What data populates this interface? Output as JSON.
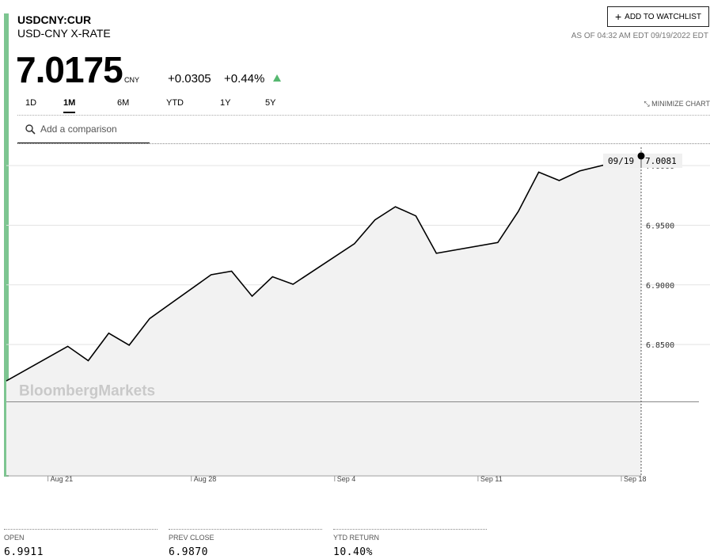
{
  "header": {
    "ticker": "USDCNY:CUR",
    "name": "USD-CNY X-RATE",
    "price": "7.0175",
    "currency": "CNY",
    "change": "+0.0305",
    "change_pct": "+0.44%",
    "change_direction": "up",
    "watchlist_label": "ADD TO WATCHLIST",
    "as_of": "AS OF 04:32 AM EDT 09/19/2022 EDT"
  },
  "tabs": [
    {
      "label": "1D",
      "active": false
    },
    {
      "label": "1M",
      "active": true
    },
    {
      "label": "6M",
      "active": false
    },
    {
      "label": "YTD",
      "active": false
    },
    {
      "label": "1Y",
      "active": false
    },
    {
      "label": "5Y",
      "active": false
    }
  ],
  "minimize_label": "MINIMIZE CHART",
  "comparison_placeholder": "Add a comparison",
  "watermark": "BloombergMarkets",
  "tooltip": {
    "date": "09/19",
    "value": "7.0081"
  },
  "stats": [
    {
      "label": "OPEN",
      "value": "6.9911"
    },
    {
      "label": "PREV CLOSE",
      "value": "6.9870"
    },
    {
      "label": "YTD RETURN",
      "value": "10.40%"
    }
  ],
  "colors": {
    "accent": "#7dc591",
    "up": "#56b870",
    "area_fill": "#f2f2f2",
    "line": "#000000"
  },
  "chart_data": {
    "type": "area",
    "y_ticks": [
      "6.8500",
      "6.9000",
      "6.9500",
      "7.0000"
    ],
    "x_ticks": [
      "Aug 21",
      "Aug 28",
      "Sep 4",
      "Sep 11",
      "Sep 18"
    ],
    "ylim": [
      6.795,
      7.018
    ],
    "reference_line": 6.8212,
    "x": [
      "2022-08-18",
      "2022-08-21",
      "2022-08-22",
      "2022-08-23",
      "2022-08-24",
      "2022-08-25",
      "2022-08-28",
      "2022-08-29",
      "2022-08-30",
      "2022-08-31",
      "2022-09-01",
      "2022-09-04",
      "2022-09-05",
      "2022-09-06",
      "2022-09-07",
      "2022-09-08",
      "2022-09-11",
      "2022-09-12",
      "2022-09-13",
      "2022-09-14",
      "2022-09-15",
      "2022-09-18"
    ],
    "series": [
      {
        "values": [
          6.8195,
          6.8485,
          6.8365,
          6.8595,
          6.8495,
          6.8718,
          6.9085,
          6.9115,
          6.8905,
          6.9068,
          6.9005,
          6.9345,
          6.9545,
          6.9655,
          6.9578,
          6.9265,
          6.9355,
          6.9615,
          6.9945,
          6.9875,
          6.9955,
          7.0081
        ]
      }
    ]
  }
}
